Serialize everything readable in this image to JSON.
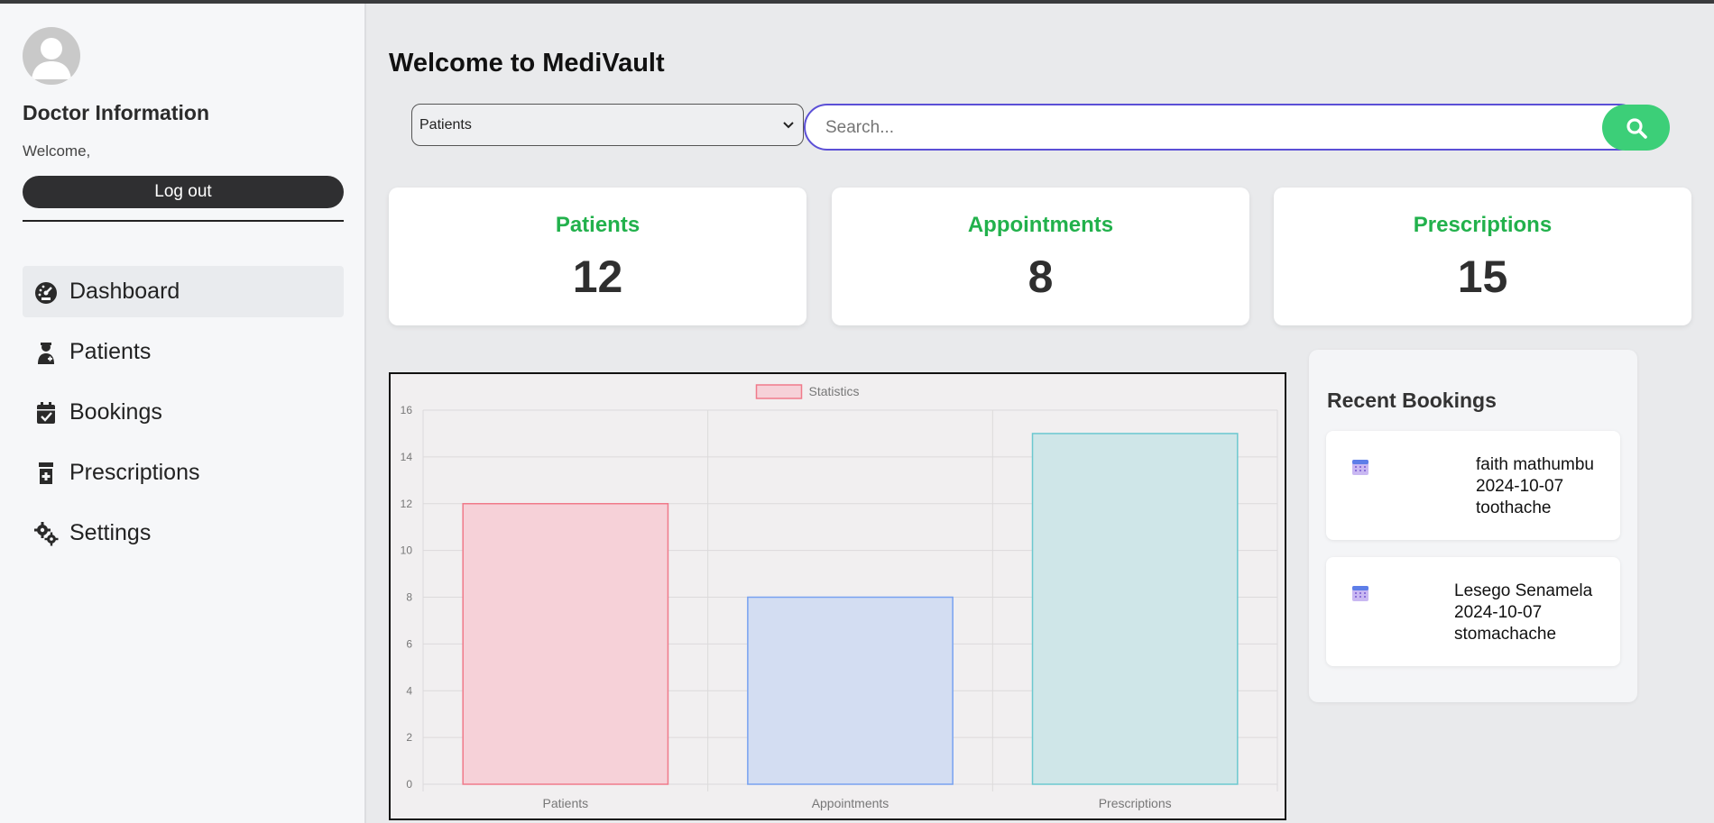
{
  "app": {
    "title": "Welcome to MediVault"
  },
  "sidebar": {
    "title": "Doctor Information",
    "welcome": "Welcome,",
    "logout_label": "Log out",
    "items": [
      {
        "label": "Dashboard",
        "icon": "gauge-icon",
        "active": true
      },
      {
        "label": "Patients",
        "icon": "user-doctor-icon"
      },
      {
        "label": "Bookings",
        "icon": "calendar-check-icon"
      },
      {
        "label": "Prescriptions",
        "icon": "prescription-bottle-icon"
      },
      {
        "label": "Settings",
        "icon": "gears-icon"
      }
    ]
  },
  "search": {
    "category_selected": "Patients",
    "placeholder": "Search..."
  },
  "stats": [
    {
      "label": "Patients",
      "value": "12"
    },
    {
      "label": "Appointments",
      "value": "8"
    },
    {
      "label": "Prescriptions",
      "value": "15"
    }
  ],
  "colors": {
    "accent_green": "#22b14c",
    "search_button": "#3ccf78",
    "search_border": "#5b4fd6",
    "bar_fills": [
      "#f6d1d8",
      "#d3ddf2",
      "#cfe6e8"
    ],
    "bar_strokes": [
      "#f07a8a",
      "#78a2f0",
      "#6cc8cf"
    ]
  },
  "chart_data": {
    "type": "bar",
    "categories": [
      "Patients",
      "Appointments",
      "Prescriptions"
    ],
    "series": [
      {
        "name": "Statistics",
        "values": [
          12,
          8,
          15
        ]
      }
    ],
    "ylim": [
      0,
      16
    ],
    "yticks": [
      "0",
      "2",
      "4",
      "6",
      "8",
      "10",
      "12",
      "14",
      "16"
    ],
    "legend": "top-center",
    "grid": true
  },
  "bookings": {
    "title": "Recent Bookings",
    "items": [
      {
        "name": "faith mathumbu",
        "date": "2024-10-07",
        "reason": "toothache"
      },
      {
        "name": "Lesego Senamela",
        "date": "2024-10-07",
        "reason": "stomachache"
      }
    ]
  }
}
